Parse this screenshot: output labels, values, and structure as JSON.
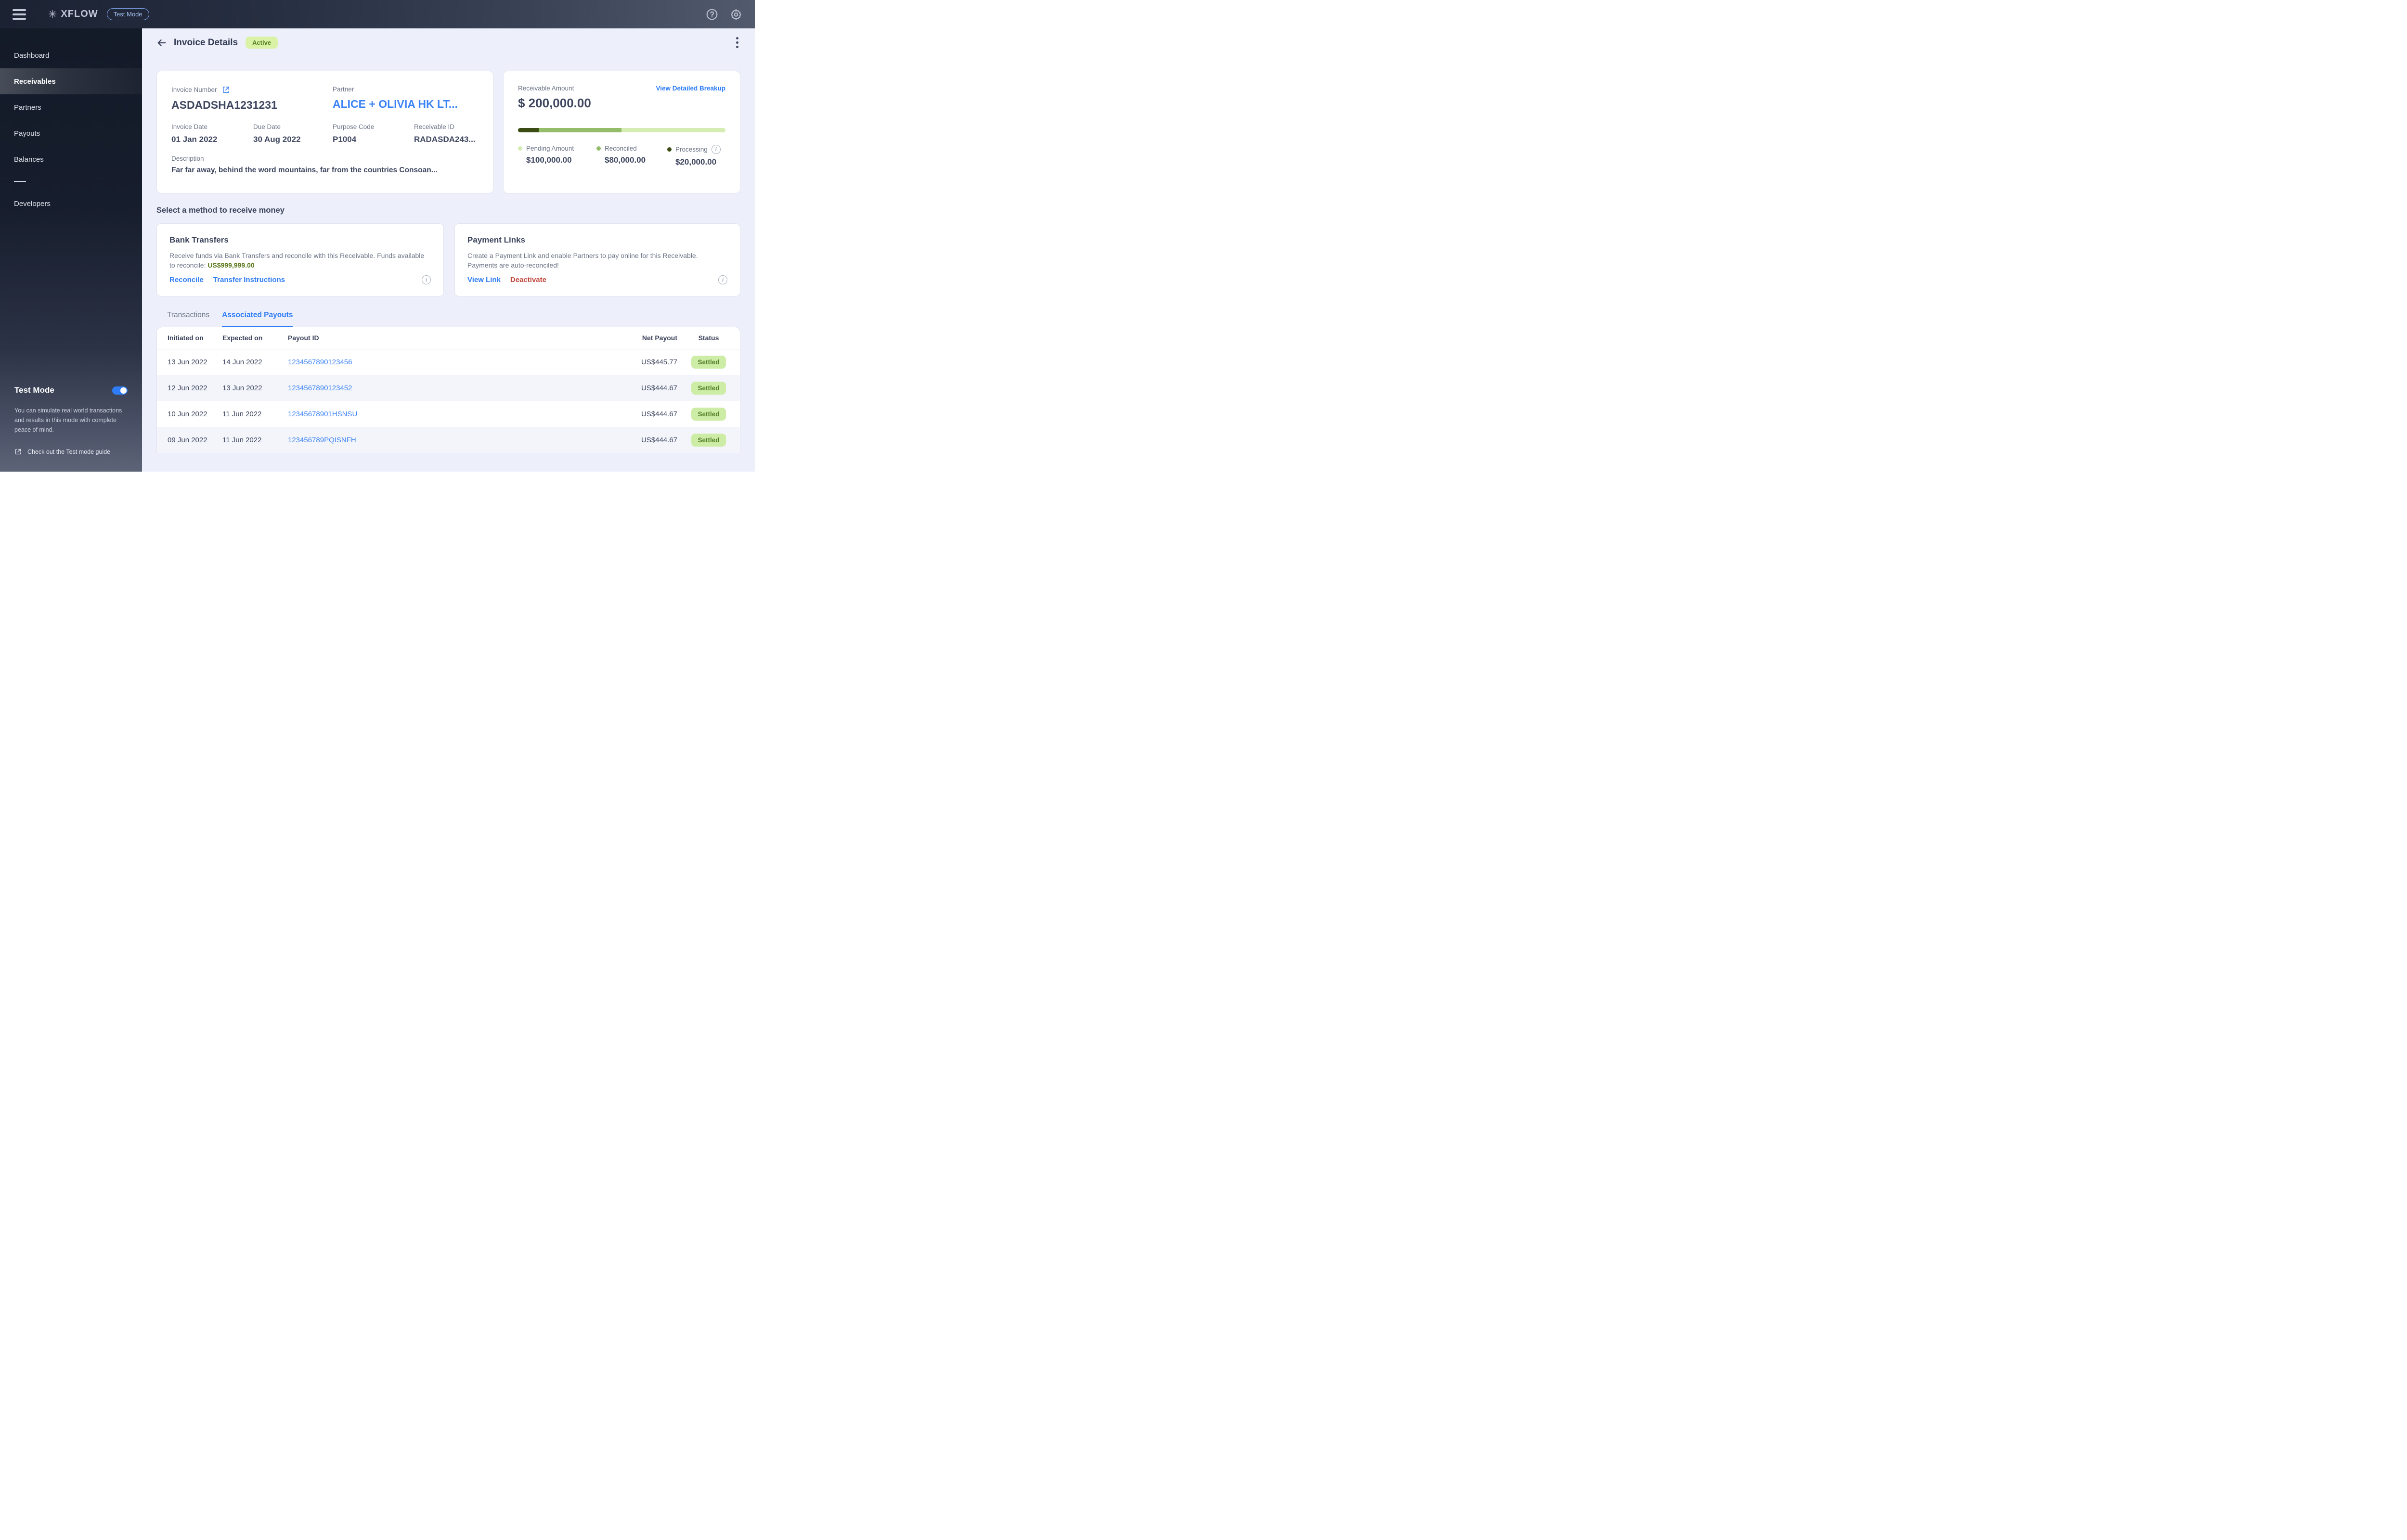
{
  "topbar": {
    "brand": "XFLOW",
    "test_mode_badge": "Test Mode"
  },
  "sidebar": {
    "items": [
      {
        "label": "Dashboard"
      },
      {
        "label": "Receivables",
        "active": true
      },
      {
        "label": "Partners"
      },
      {
        "label": "Payouts"
      },
      {
        "label": "Balances"
      },
      {
        "label": "Developers"
      }
    ],
    "test_mode": {
      "title": "Test Mode",
      "enabled": true,
      "description": "You can simulate real world transactions and results in this mode with complete peace of mind.",
      "guide_link": "Check out the Test mode guide"
    }
  },
  "header": {
    "title": "Invoice Details",
    "status_badge": "Active"
  },
  "invoice": {
    "invoice_number_label": "Invoice Number",
    "invoice_number": "ASDADSHA1231231",
    "partner_label": "Partner",
    "partner": "ALICE + OLIVIA HK LT...",
    "invoice_date_label": "Invoice Date",
    "invoice_date": "01 Jan 2022",
    "due_date_label": "Due Date",
    "due_date": "30 Aug 2022",
    "purpose_code_label": "Purpose Code",
    "purpose_code": "P1004",
    "receivable_id_label": "Receivable ID",
    "receivable_id": "RADASDA243...",
    "description_label": "Description",
    "description": "Far far away, behind the word mountains, far from the countries Consoan..."
  },
  "receivable": {
    "label": "Receivable Amount",
    "amount": "$ 200,000.00",
    "breakup_link": "View Detailed Breakup",
    "progress_segments": [
      {
        "name": "Processing",
        "percent": 10,
        "color": "#3a4b13"
      },
      {
        "name": "Reconciled",
        "percent": 40,
        "color": "#95bd69"
      },
      {
        "name": "Pending",
        "percent": 50,
        "color": "#d5edb3"
      }
    ],
    "legend": [
      {
        "label": "Pending Amount",
        "value": "$100,000.00",
        "dot_color": "#d5edb3"
      },
      {
        "label": "Reconciled",
        "value": "$80,000.00",
        "dot_color": "#95bd69"
      },
      {
        "label": "Processing",
        "value": "$20,000.00",
        "dot_color": "#3a4b13"
      }
    ]
  },
  "methods": {
    "heading": "Select a method to receive money",
    "bank_transfers": {
      "title": "Bank Transfers",
      "description": "Receive funds via Bank Transfers and reconcile with this Receivable. Funds available to reconcile: ",
      "highlight_amount": "US$999,999.00",
      "links": [
        "Reconcile",
        "Transfer Instructions"
      ]
    },
    "payment_links": {
      "title": "Payment Links",
      "description": "Create a Payment Link and enable Partners to pay online for this Receivable. Payments are auto-reconciled!",
      "links": [
        "View Link",
        "Deactivate"
      ]
    }
  },
  "tabs": [
    {
      "label": "Transactions",
      "active": false
    },
    {
      "label": "Associated Payouts",
      "active": true
    }
  ],
  "table": {
    "headers": [
      "Initiated on",
      "Expected on",
      "Payout ID",
      "Net Payout",
      "Status"
    ],
    "rows": [
      {
        "initiated_on": "13 Jun 2022",
        "expected_on": "14 Jun 2022",
        "payout_id": "1234567890123456",
        "net_payout": "US$445.77",
        "status": "Settled"
      },
      {
        "initiated_on": "12 Jun 2022",
        "expected_on": "13 Jun 2022",
        "payout_id": "1234567890123452",
        "net_payout": "US$444.67",
        "status": "Settled"
      },
      {
        "initiated_on": "10 Jun 2022",
        "expected_on": "11 Jun 2022",
        "payout_id": "12345678901HSNSU",
        "net_payout": "US$444.67",
        "status": "Settled"
      },
      {
        "initiated_on": "09 Jun 2022",
        "expected_on": "11 Jun 2022",
        "payout_id": "123456789PQISNFH",
        "net_payout": "US$444.67",
        "status": "Settled"
      }
    ]
  },
  "colors": {
    "accent_blue": "#2e7cf6",
    "badge_green_bg": "#daf2a6",
    "badge_green_text": "#567d22",
    "danger_red": "#c0453a",
    "olive_amount": "#5c7a1e"
  }
}
